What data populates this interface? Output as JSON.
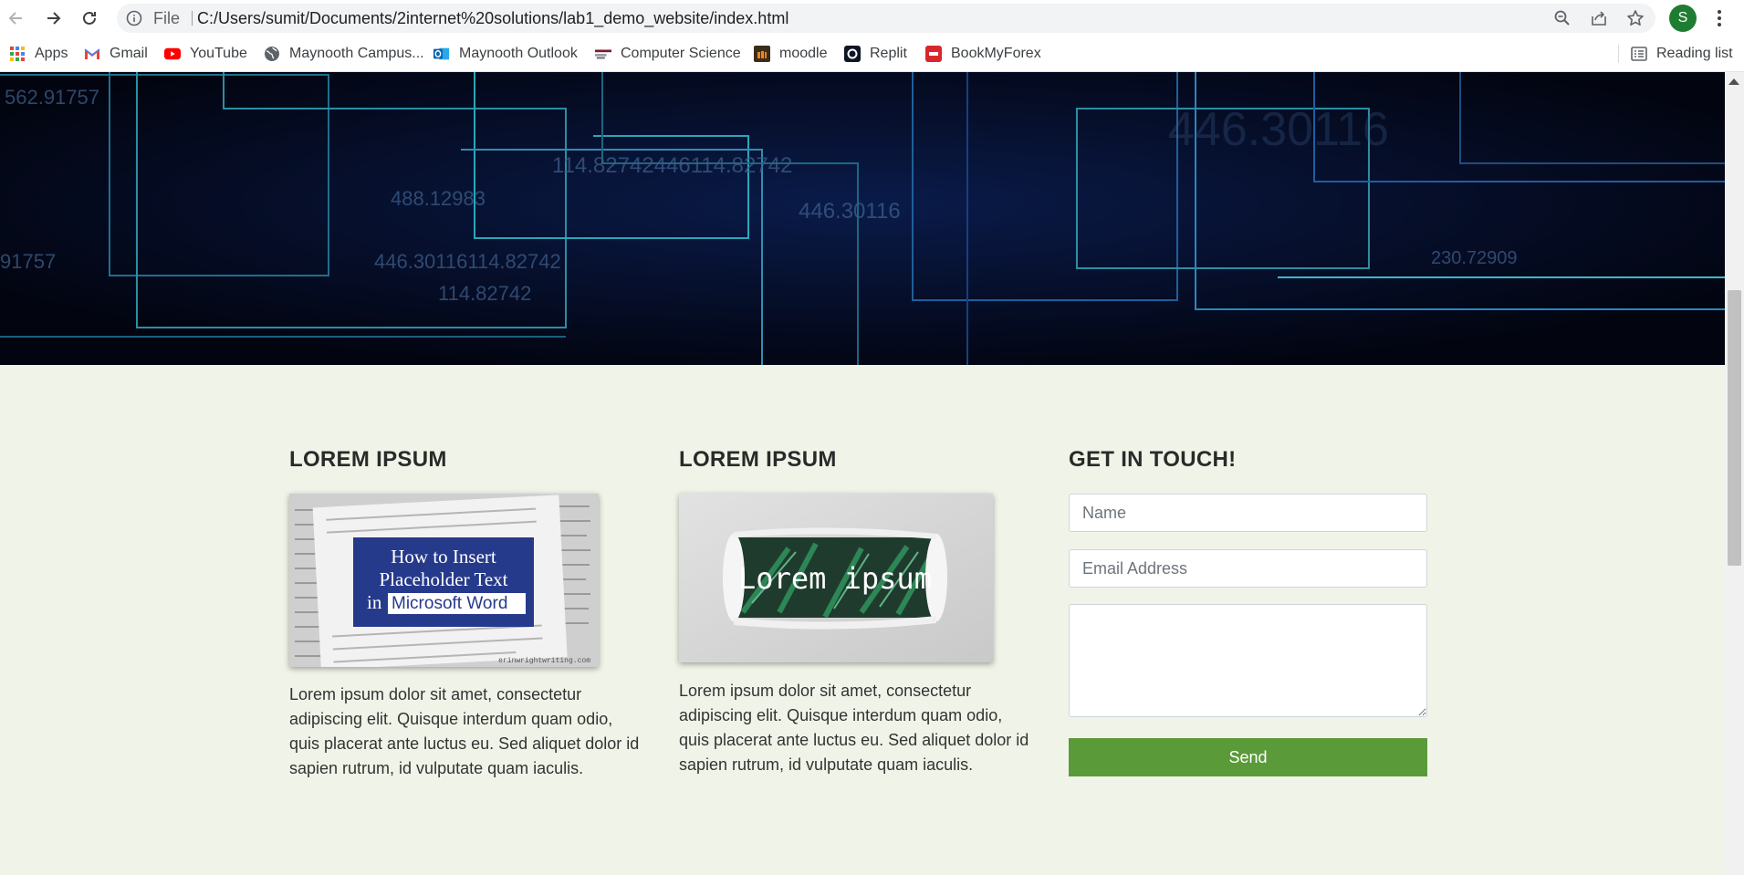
{
  "browser": {
    "scheme_label": "File",
    "url": "C:/Users/sumit/Documents/2internet%20solutions/lab1_demo_website/index.html",
    "profile_initial": "S",
    "bookmarks": [
      {
        "label": "Apps",
        "icon": "apps-grid-icon"
      },
      {
        "label": "Gmail",
        "icon": "gmail-icon"
      },
      {
        "label": "YouTube",
        "icon": "youtube-icon"
      },
      {
        "label": "Maynooth Campus...",
        "icon": "globe-icon"
      },
      {
        "label": "Maynooth Outlook",
        "icon": "outlook-icon"
      },
      {
        "label": "Computer Science",
        "icon": "cs-icon"
      },
      {
        "label": "moodle",
        "icon": "moodle-icon"
      },
      {
        "label": "Replit",
        "icon": "replit-icon"
      },
      {
        "label": "BookMyForex",
        "icon": "bookmyforex-icon"
      }
    ],
    "reading_list": "Reading list"
  },
  "hero": {
    "overlay_numbers": [
      "562.91757",
      "488.12983",
      "114.82742446114.82742",
      "446.30116",
      "446.30116",
      "91757",
      "446.30116114.82742",
      "114.82742",
      "230.72909"
    ]
  },
  "columns": [
    {
      "title": "LOREM IPSUM",
      "image_caption": [
        "How to Insert",
        "Placeholder Text",
        "in",
        "Microsoft Word"
      ],
      "image_watermark": "erinwrightwriting.com",
      "text": "Lorem ipsum dolor sit amet, consectetur adipiscing elit. Quisque interdum quam odio, quis placerat ante luctus eu. Sed aliquet dolor id sapien rutrum, id vulputate quam iaculis."
    },
    {
      "title": "LOREM IPSUM",
      "image_caption": "Lorem ipsum",
      "text": "Lorem ipsum dolor sit amet, consectetur adipiscing elit. Quisque interdum quam odio, quis placerat ante luctus eu. Sed aliquet dolor id sapien rutrum, id vulputate quam iaculis."
    }
  ],
  "contact": {
    "title": "GET IN TOUCH!",
    "name_placeholder": "Name",
    "email_placeholder": "Email Address",
    "message_value": "",
    "send_label": "Send"
  },
  "colors": {
    "page_bg": "#f0f4e8",
    "send_button": "#5a9a39",
    "hero_bg": "#04081c"
  }
}
